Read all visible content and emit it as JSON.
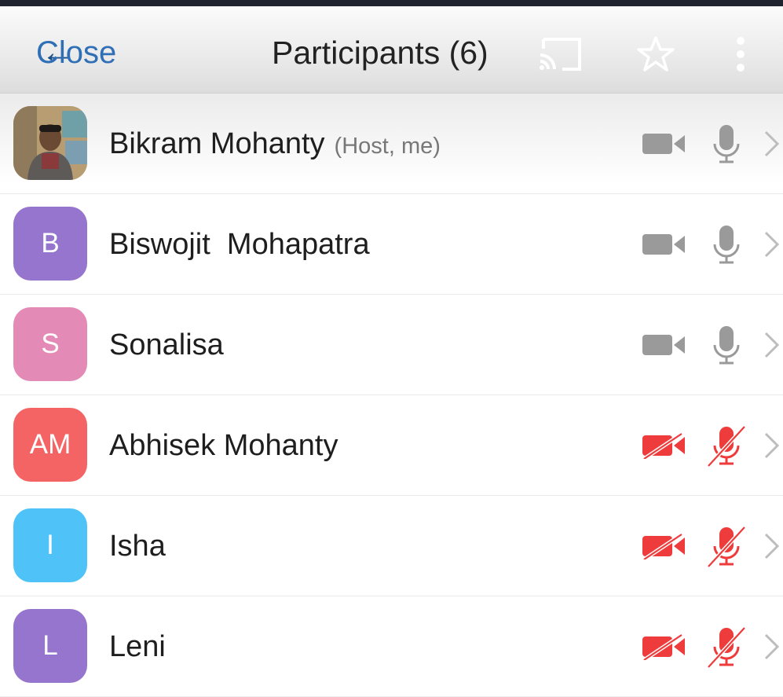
{
  "header": {
    "close_label": "Close",
    "title": "Participants (6)"
  },
  "colors": {
    "link_blue": "#2f6fb6",
    "muted_red": "#ee3b3b",
    "icon_gray": "#9a9a9a"
  },
  "participants": [
    {
      "name": "Bikram Mohanty",
      "role": "(Host, me)",
      "avatar": "photo",
      "initials": "",
      "avatar_color": "#c8b28a",
      "video": "on",
      "mic": "on"
    },
    {
      "name": "Biswojit  Mohapatra",
      "role": "",
      "avatar": "initials",
      "initials": "B",
      "avatar_color": "#9575cd",
      "video": "on",
      "mic": "on"
    },
    {
      "name": "Sonalisa",
      "role": "",
      "avatar": "initials",
      "initials": "S",
      "avatar_color": "#e48ab7",
      "video": "on",
      "mic": "on"
    },
    {
      "name": "Abhisek Mohanty",
      "role": "",
      "avatar": "initials",
      "initials": "AM",
      "avatar_color": "#f46464",
      "video": "off",
      "mic": "off"
    },
    {
      "name": "Isha",
      "role": "",
      "avatar": "initials",
      "initials": "I",
      "avatar_color": "#4fc3f7",
      "video": "off",
      "mic": "off"
    },
    {
      "name": "Leni",
      "role": "",
      "avatar": "initials",
      "initials": "L",
      "avatar_color": "#9575cd",
      "video": "off",
      "mic": "off"
    }
  ]
}
